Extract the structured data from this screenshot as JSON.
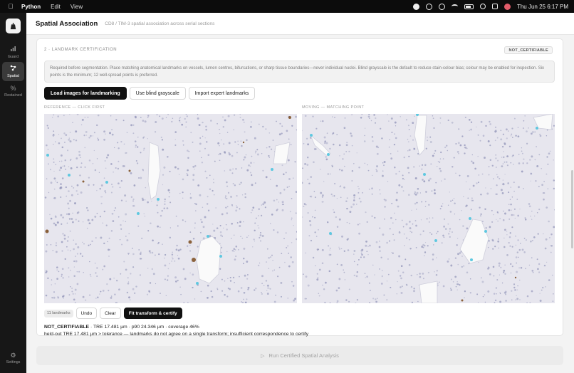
{
  "menubar": {
    "app": "Python",
    "menus": [
      "Edit",
      "View"
    ],
    "clock": "Thu Jun 25  6:17 PM"
  },
  "rail": {
    "items": [
      {
        "label": "Guard",
        "icon": "chart-icon"
      },
      {
        "label": "Spatial",
        "icon": "spatial-icon",
        "active": true
      },
      {
        "label": "Restained",
        "icon": "percent-icon"
      }
    ],
    "settings_label": "Settings"
  },
  "header": {
    "title": "Spatial Association",
    "subtitle": "CD8 / TIM-3 spatial association across serial sections"
  },
  "card": {
    "section_label": "2 · LANDMARK CERTIFICATION",
    "badge": "NOT_CERTIFIABLE",
    "notice": "Required before segmentation. Place matching anatomical landmarks on vessels, lumen centres, bifurcations, or sharp tissue boundaries—never individual nuclei. Blind grayscale is the default to reduce stain-colour bias; colour may be enabled for inspection. Six points is the minimum; 12 well-spread points is preferred.",
    "buttons": {
      "load": "Load images for landmarking",
      "grayscale": "Use blind grayscale",
      "import": "Import expert landmarks"
    },
    "reference_label": "REFERENCE — CLICK FIRST",
    "moving_label": "MOVING — MATCHING POINT",
    "landmark_count": "11 landmarks",
    "undo": "Undo",
    "clear": "Clear",
    "fit": "Fit transform & certify",
    "status_head": "NOT_CERTIFIABLE",
    "status_line1": " · TRE 17.481 µm · p90 24.346 µm · coverage 46%",
    "status_line2": "held-out TRE 17.481 µm > tolerance — landmarks do not agree on a single transform; insufficient correspondence to certify"
  },
  "run_button": "Run Certified Spatial Analysis",
  "colors": {
    "landmark": "#5ec8e0",
    "tissue": "#e7e6ee",
    "nuclei": "#8c8fb5",
    "dab": "#7a4a1c"
  }
}
